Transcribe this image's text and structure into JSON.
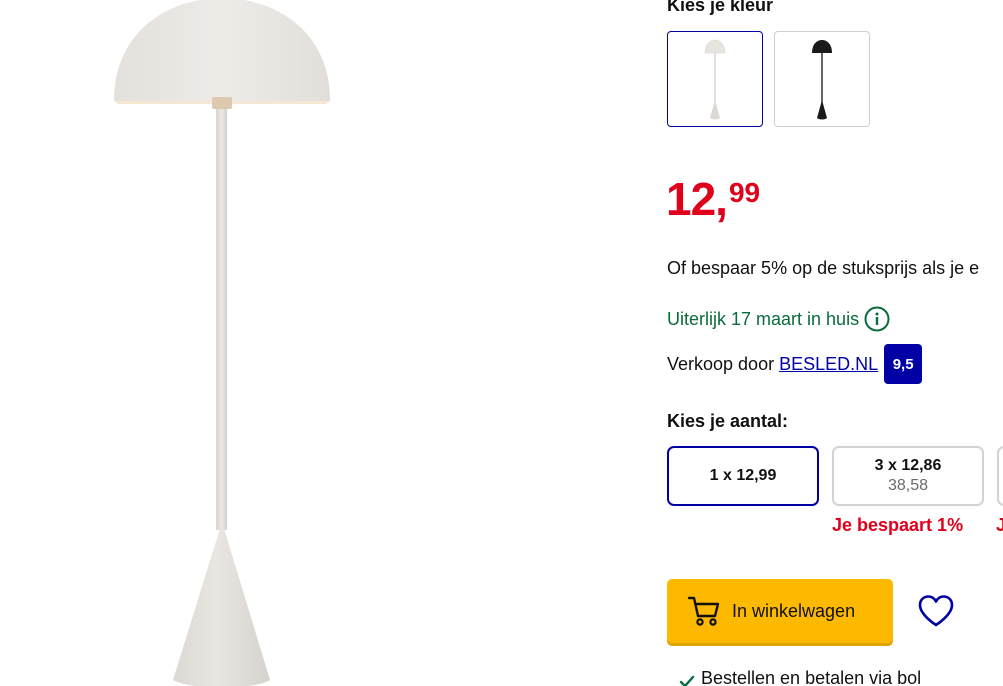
{
  "product": {
    "image_alt": "Vloerlamp beige"
  },
  "color_picker": {
    "heading": "Kies je kleur",
    "options": [
      {
        "name": "beige",
        "selected": true,
        "color": "#e7e2dc"
      },
      {
        "name": "zwart",
        "selected": false,
        "color": "#1a1a1a"
      }
    ]
  },
  "price": {
    "main": "12,",
    "cents": "99"
  },
  "offer": {
    "savings_text": "Of bespaar 5% op de stuksprijs als je e"
  },
  "delivery": {
    "text": "Uiterlijk 17 maart in huis"
  },
  "seller": {
    "prefix": "Verkoop door",
    "name": "BESLED.NL",
    "rating": "9,5"
  },
  "quantity": {
    "heading": "Kies je aantal:",
    "options": [
      {
        "label": "1 x 12,99",
        "total": "",
        "savings": "",
        "selected": true
      },
      {
        "label": "3 x 12,86",
        "total": "38,58",
        "savings": "Je bespaart 1%",
        "selected": false
      },
      {
        "label": "",
        "total": "",
        "savings": "J",
        "selected": false
      }
    ]
  },
  "actions": {
    "cart_label": "In winkelwagen"
  },
  "usp": {
    "text": "Bestellen en betalen via bol"
  },
  "colors": {
    "price_red": "#e0001b",
    "brand_blue": "#0000a4",
    "cart_yellow": "#fcb900",
    "delivery_green": "#0a6b3b"
  }
}
